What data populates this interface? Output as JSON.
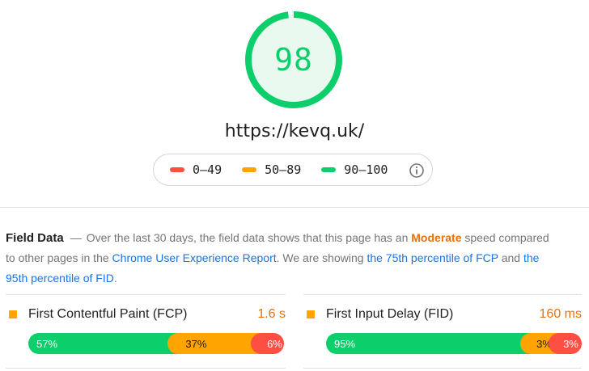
{
  "gauge": {
    "score": "98",
    "fraction": 0.98,
    "color": "#0cce6b",
    "fill": "#e9f9ef"
  },
  "url": "https://kevq.uk/",
  "legend": {
    "items": [
      {
        "range": "0–49",
        "color": "#ff4e42"
      },
      {
        "range": "50–89",
        "color": "#ffa400"
      },
      {
        "range": "90–100",
        "color": "#0cce6b"
      }
    ],
    "info_icon": "info-icon"
  },
  "field_data": {
    "title": "Field Data",
    "dash": "—",
    "text1": "Over the last 30 days, the field data shows that this page has an",
    "rating": "Moderate",
    "text2": "speed compared to other pages in the",
    "link1": "Chrome User Experience Report",
    "text3": ". We are showing",
    "link2": "the 75th percentile of FCP",
    "text4": "and",
    "link3": "the 95th percentile of FID",
    "text5": "."
  },
  "metrics": [
    {
      "name": "First Contentful Paint (FCP)",
      "value": "1.6 s",
      "distribution": [
        {
          "label": "57%",
          "percent": 57
        },
        {
          "label": "37%",
          "percent": 37
        },
        {
          "label": "6%",
          "percent": 6
        }
      ]
    },
    {
      "name": "First Input Delay (FID)",
      "value": "160 ms",
      "distribution": [
        {
          "label": "95%",
          "percent": 95
        },
        {
          "label": "3%",
          "percent": 3
        },
        {
          "label": "3%",
          "percent": 3
        }
      ]
    }
  ]
}
